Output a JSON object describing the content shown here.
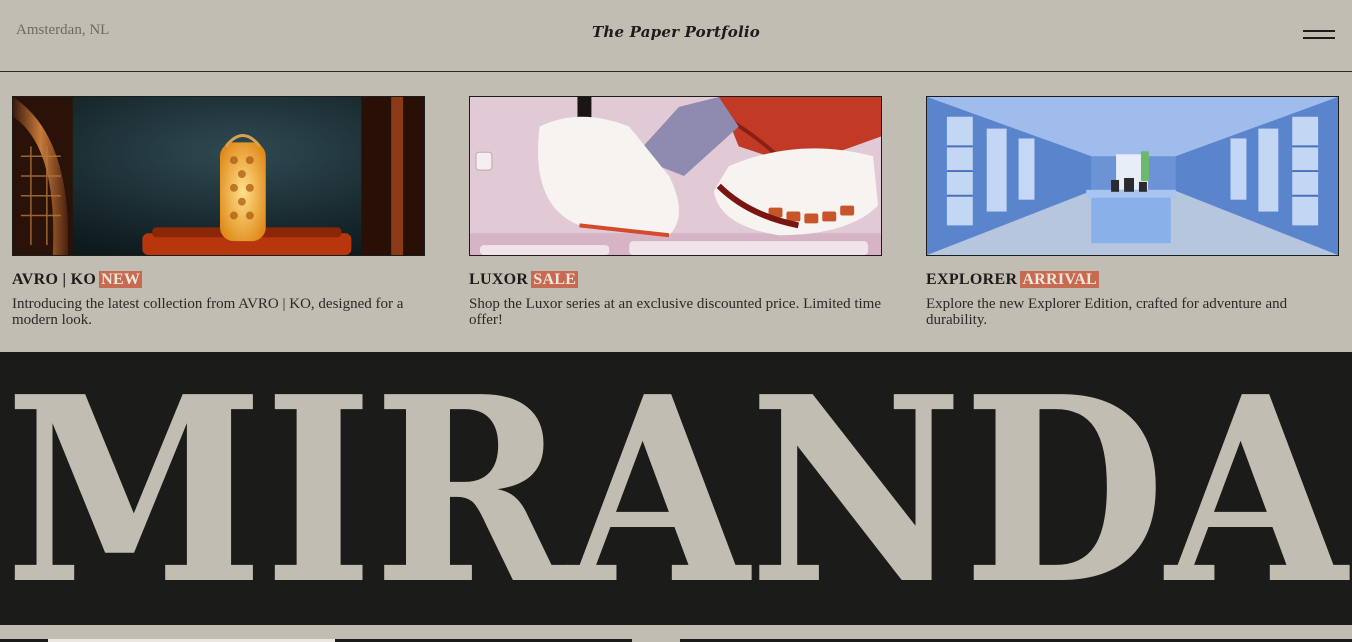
{
  "header": {
    "location": "Amsterdan, NL",
    "brand": "The Paper Portfolio",
    "menu_icon": "hamburger-menu-icon"
  },
  "cards": [
    {
      "title": "AVRO | KO",
      "tag": "NEW",
      "description": "Introducing the latest collection from AVRO | KO, designed for a modern look.",
      "image": "lantern-interior-image"
    },
    {
      "title": "LUXOR",
      "tag": "SALE",
      "description": "Shop the Luxor series at an exclusive discounted price. Limited time offer!",
      "image": "sneakers-image"
    },
    {
      "title": "EXPLORER",
      "tag": "ARRIVAL",
      "description": "Explore the new Explorer Edition, crafted for adventure and durability.",
      "image": "blue-store-interior-image"
    }
  ],
  "hero": {
    "word": "MIRANDA"
  },
  "colors": {
    "background": "#c2bdb3",
    "dark": "#1b1b19",
    "accent": "#c76a52"
  }
}
